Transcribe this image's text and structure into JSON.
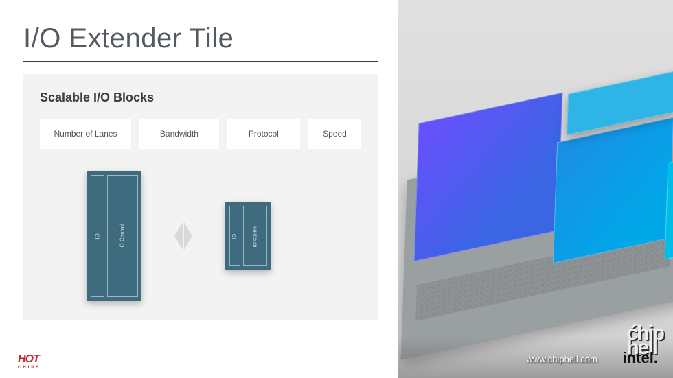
{
  "slide": {
    "title": "I/O Extender Tile",
    "panel_title": "Scalable I/O Blocks",
    "blocks": {
      "lanes": "Number of Lanes",
      "bandwidth": "Bandwidth",
      "protocol": "Protocol",
      "speed": "Speed"
    },
    "chip": {
      "io": "IO",
      "control": "IO Control"
    }
  },
  "footer": {
    "hotchips": "HOT",
    "hotchips_sub": "CHIPS",
    "url": "www.chiphell.com",
    "intel": "intel.",
    "chiphell_l1": "ćhip",
    "chiphell_l2": "hell"
  }
}
